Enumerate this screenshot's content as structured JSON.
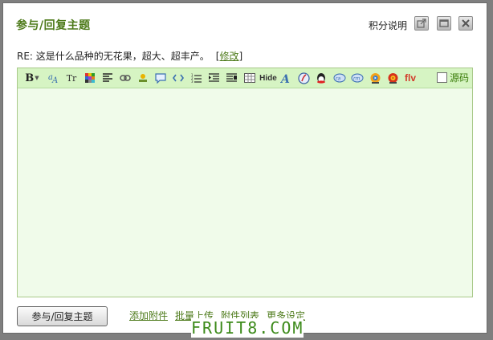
{
  "dialog": {
    "title": "参与/回复主题",
    "scoring_link": "积分说明",
    "buttons": [
      "popout-icon",
      "maximize-icon",
      "close-icon"
    ]
  },
  "reply": {
    "prefix": "RE: 这是什么品种的无花果，超大、超丰产。",
    "bracket_open": "[",
    "edit_link": "修改",
    "bracket_close": "]"
  },
  "editor": {
    "toolbar_icons": [
      "bold-icon",
      "font-color-icon",
      "font-size-icon",
      "background-color-icon",
      "align-icon",
      "link-icon",
      "image-icon",
      "quote-icon",
      "code-icon",
      "ordered-list-icon",
      "indent-icon",
      "outdent-icon",
      "table-icon",
      "hide-icon",
      "free-text-icon",
      "flash-icon",
      "qq-icon",
      "audio-icon",
      "video-icon",
      "media-player-icon",
      "real-player-icon",
      "flv-icon"
    ],
    "bold_glyph": "B",
    "font_size_glyph": "Tr",
    "hide_label": "Hide",
    "flv_label": "flv",
    "source_label": "源码",
    "source_checked": false,
    "content": ""
  },
  "footer": {
    "submit_label": "参与/回复主题",
    "links": [
      "添加附件",
      "批量上传",
      "附件列表",
      "更多设定"
    ]
  },
  "watermark": "FRUIT8.COM",
  "colors": {
    "accent": "#4d7a1a",
    "toolbar_bg": "#d6f4c3",
    "editor_bg": "#f0fbea",
    "backdrop": "#7f7f7f"
  }
}
